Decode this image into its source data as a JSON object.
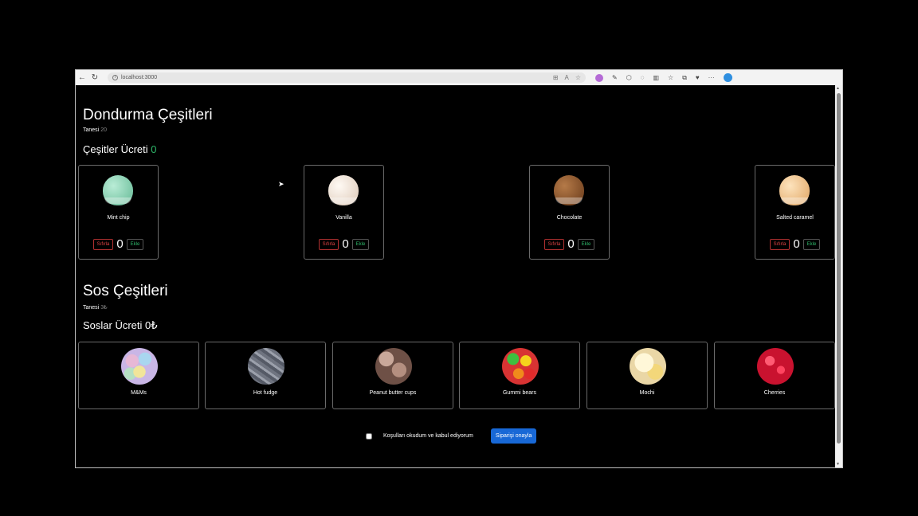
{
  "browser": {
    "url": "localhost:3000"
  },
  "ice_section": {
    "title": "Dondurma Çeşitleri",
    "unit_label": "Tanesi",
    "unit_price": "20",
    "total_label": "Çeşitler Ücreti",
    "total_value": "0",
    "items": [
      {
        "name": "Mint chip",
        "reset": "Sıfırla",
        "qty": "0",
        "add": "Ekle",
        "color": "#8fd3b6"
      },
      {
        "name": "Vanilla",
        "reset": "Sıfırla",
        "qty": "0",
        "add": "Ekle",
        "color": "#f4ece4"
      },
      {
        "name": "Chocolate",
        "reset": "Sıfırla",
        "qty": "0",
        "add": "Ekle",
        "color": "#9a5f35"
      },
      {
        "name": "Salted caramel",
        "reset": "Sıfırla",
        "qty": "0",
        "add": "Ekle",
        "color": "#f3cf9e"
      }
    ]
  },
  "sauce_section": {
    "title": "Sos Çeşitleri",
    "unit_label": "Tanesi",
    "unit_price": "3₺",
    "total_label": "Soslar Ücreti 0₺",
    "items": [
      {
        "name": "M&Ms",
        "color": "#c9b6e6"
      },
      {
        "name": "Hot fudge",
        "color": "#7c7f8c"
      },
      {
        "name": "Peanut butter cups",
        "color": "#9a776a"
      },
      {
        "name": "Gummi bears",
        "color": "#e23b3b"
      },
      {
        "name": "Mochi",
        "color": "#f1e3b0"
      },
      {
        "name": "Cherries",
        "color": "#d81c3c"
      }
    ]
  },
  "order": {
    "terms_label": "Koşulları okudum ve kabul ediyorum",
    "confirm_label": "Siparişi onayla"
  },
  "colors": {
    "accent_green": "#2eb86a",
    "danger_red": "#e04444",
    "primary_blue": "#1868d6"
  }
}
